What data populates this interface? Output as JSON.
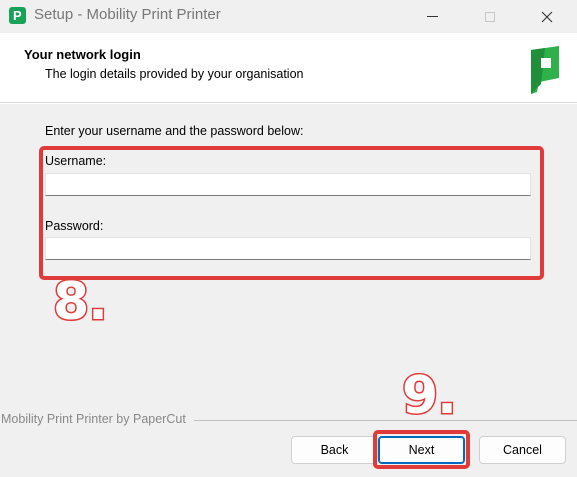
{
  "window": {
    "title": "Setup - Mobility Print Printer",
    "app_icon": "papercut-p-icon",
    "app_icon_letter": "P",
    "minimize_icon": "minimize-icon",
    "maximize_icon": "maximize-icon",
    "close_icon": "close-icon"
  },
  "header": {
    "title": "Your network login",
    "subtitle": "The login details provided by your organisation",
    "logo_icon": "papercut-logo-icon"
  },
  "form": {
    "instruction": "Enter your username and the password below:",
    "username_label": "Username:",
    "username_value": "",
    "password_label": "Password:",
    "password_value": ""
  },
  "annotations": {
    "step_fields": "8.",
    "step_next": "9.",
    "highlight_color": "#e03a3a"
  },
  "footer": {
    "branding": "Mobility Print Printer by PaperCut",
    "back_label": "Back",
    "next_label": "Next",
    "cancel_label": "Cancel"
  },
  "colors": {
    "accent": "#0067c0",
    "brand_green": "#19a35a",
    "dialog_bg": "#f0f0f0"
  }
}
